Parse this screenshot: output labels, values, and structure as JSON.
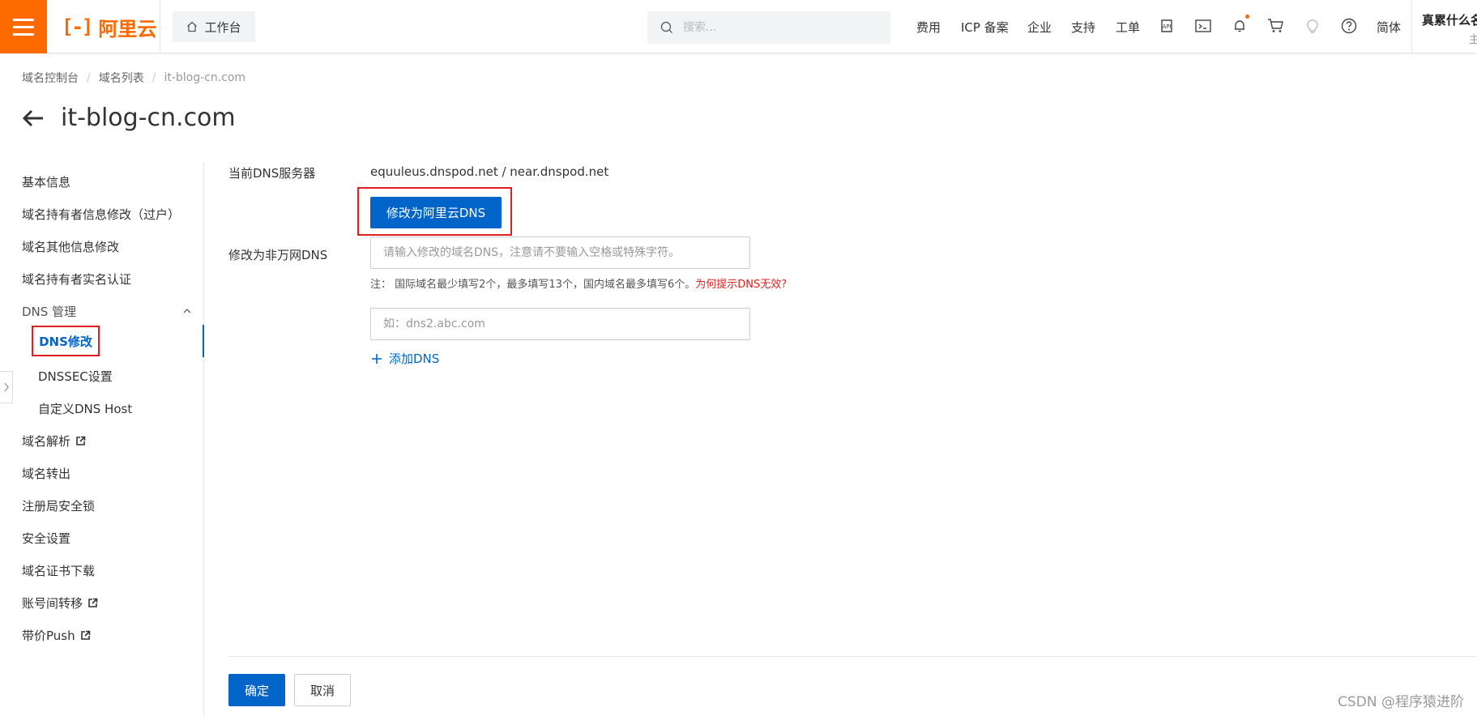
{
  "header": {
    "logo_mark": "[-]",
    "logo_text": "阿里云",
    "workbench_label": "工作台",
    "search_placeholder": "搜索...",
    "nav": [
      "费用",
      "ICP 备案",
      "企业",
      "支持",
      "工单"
    ],
    "lang_label": "简体",
    "user_name": "真累什么名",
    "user_sub": "主",
    "accent_color": "#ff6a00",
    "icons": [
      "api-icon",
      "terminal-icon",
      "bell-icon",
      "cart-icon",
      "lightbulb-icon",
      "help-icon"
    ]
  },
  "breadcrumb": {
    "items": [
      "域名控制台",
      "域名列表",
      "it-blog-cn.com"
    ]
  },
  "page": {
    "title": "it-blog-cn.com"
  },
  "sidebar": {
    "items": {
      "basic_info": "基本信息",
      "holder_change": "域名持有者信息修改（过户）",
      "other_info": "域名其他信息修改",
      "realname": "域名持有者实名认证",
      "dns_group": "DNS 管理",
      "dns_modify": "DNS修改",
      "dnssec": "DNSSEC设置",
      "custom_dns_host": "自定义DNS Host",
      "domain_resolve": "域名解析",
      "transfer_out": "域名转出",
      "registry_lock": "注册局安全锁",
      "security": "安全设置",
      "cert_download": "域名证书下载",
      "account_transfer": "账号间转移",
      "price_push": "带价Push"
    }
  },
  "form": {
    "current_dns_label": "当前DNS服务器",
    "current_dns_value": "equuleus.dnspod.net / near.dnspod.net",
    "switch_button": "修改为阿里云DNS",
    "custom_dns_label": "修改为非万网DNS",
    "dns1_placeholder": "请输入修改的域名DNS，注意请不要输入空格或特殊字符。",
    "note_text": "注： 国际域名最少填写2个，最多填写13个，国内域名最多填写6个。",
    "note_link": "为何提示DNS无效?",
    "dns2_placeholder": "如：dns2.abc.com",
    "add_dns": "添加DNS",
    "primary_color": "#0064c8",
    "highlight_color": "#e02020"
  },
  "footer": {
    "ok": "确定",
    "cancel": "取消",
    "watermark": "CSDN @程序猿进阶"
  }
}
